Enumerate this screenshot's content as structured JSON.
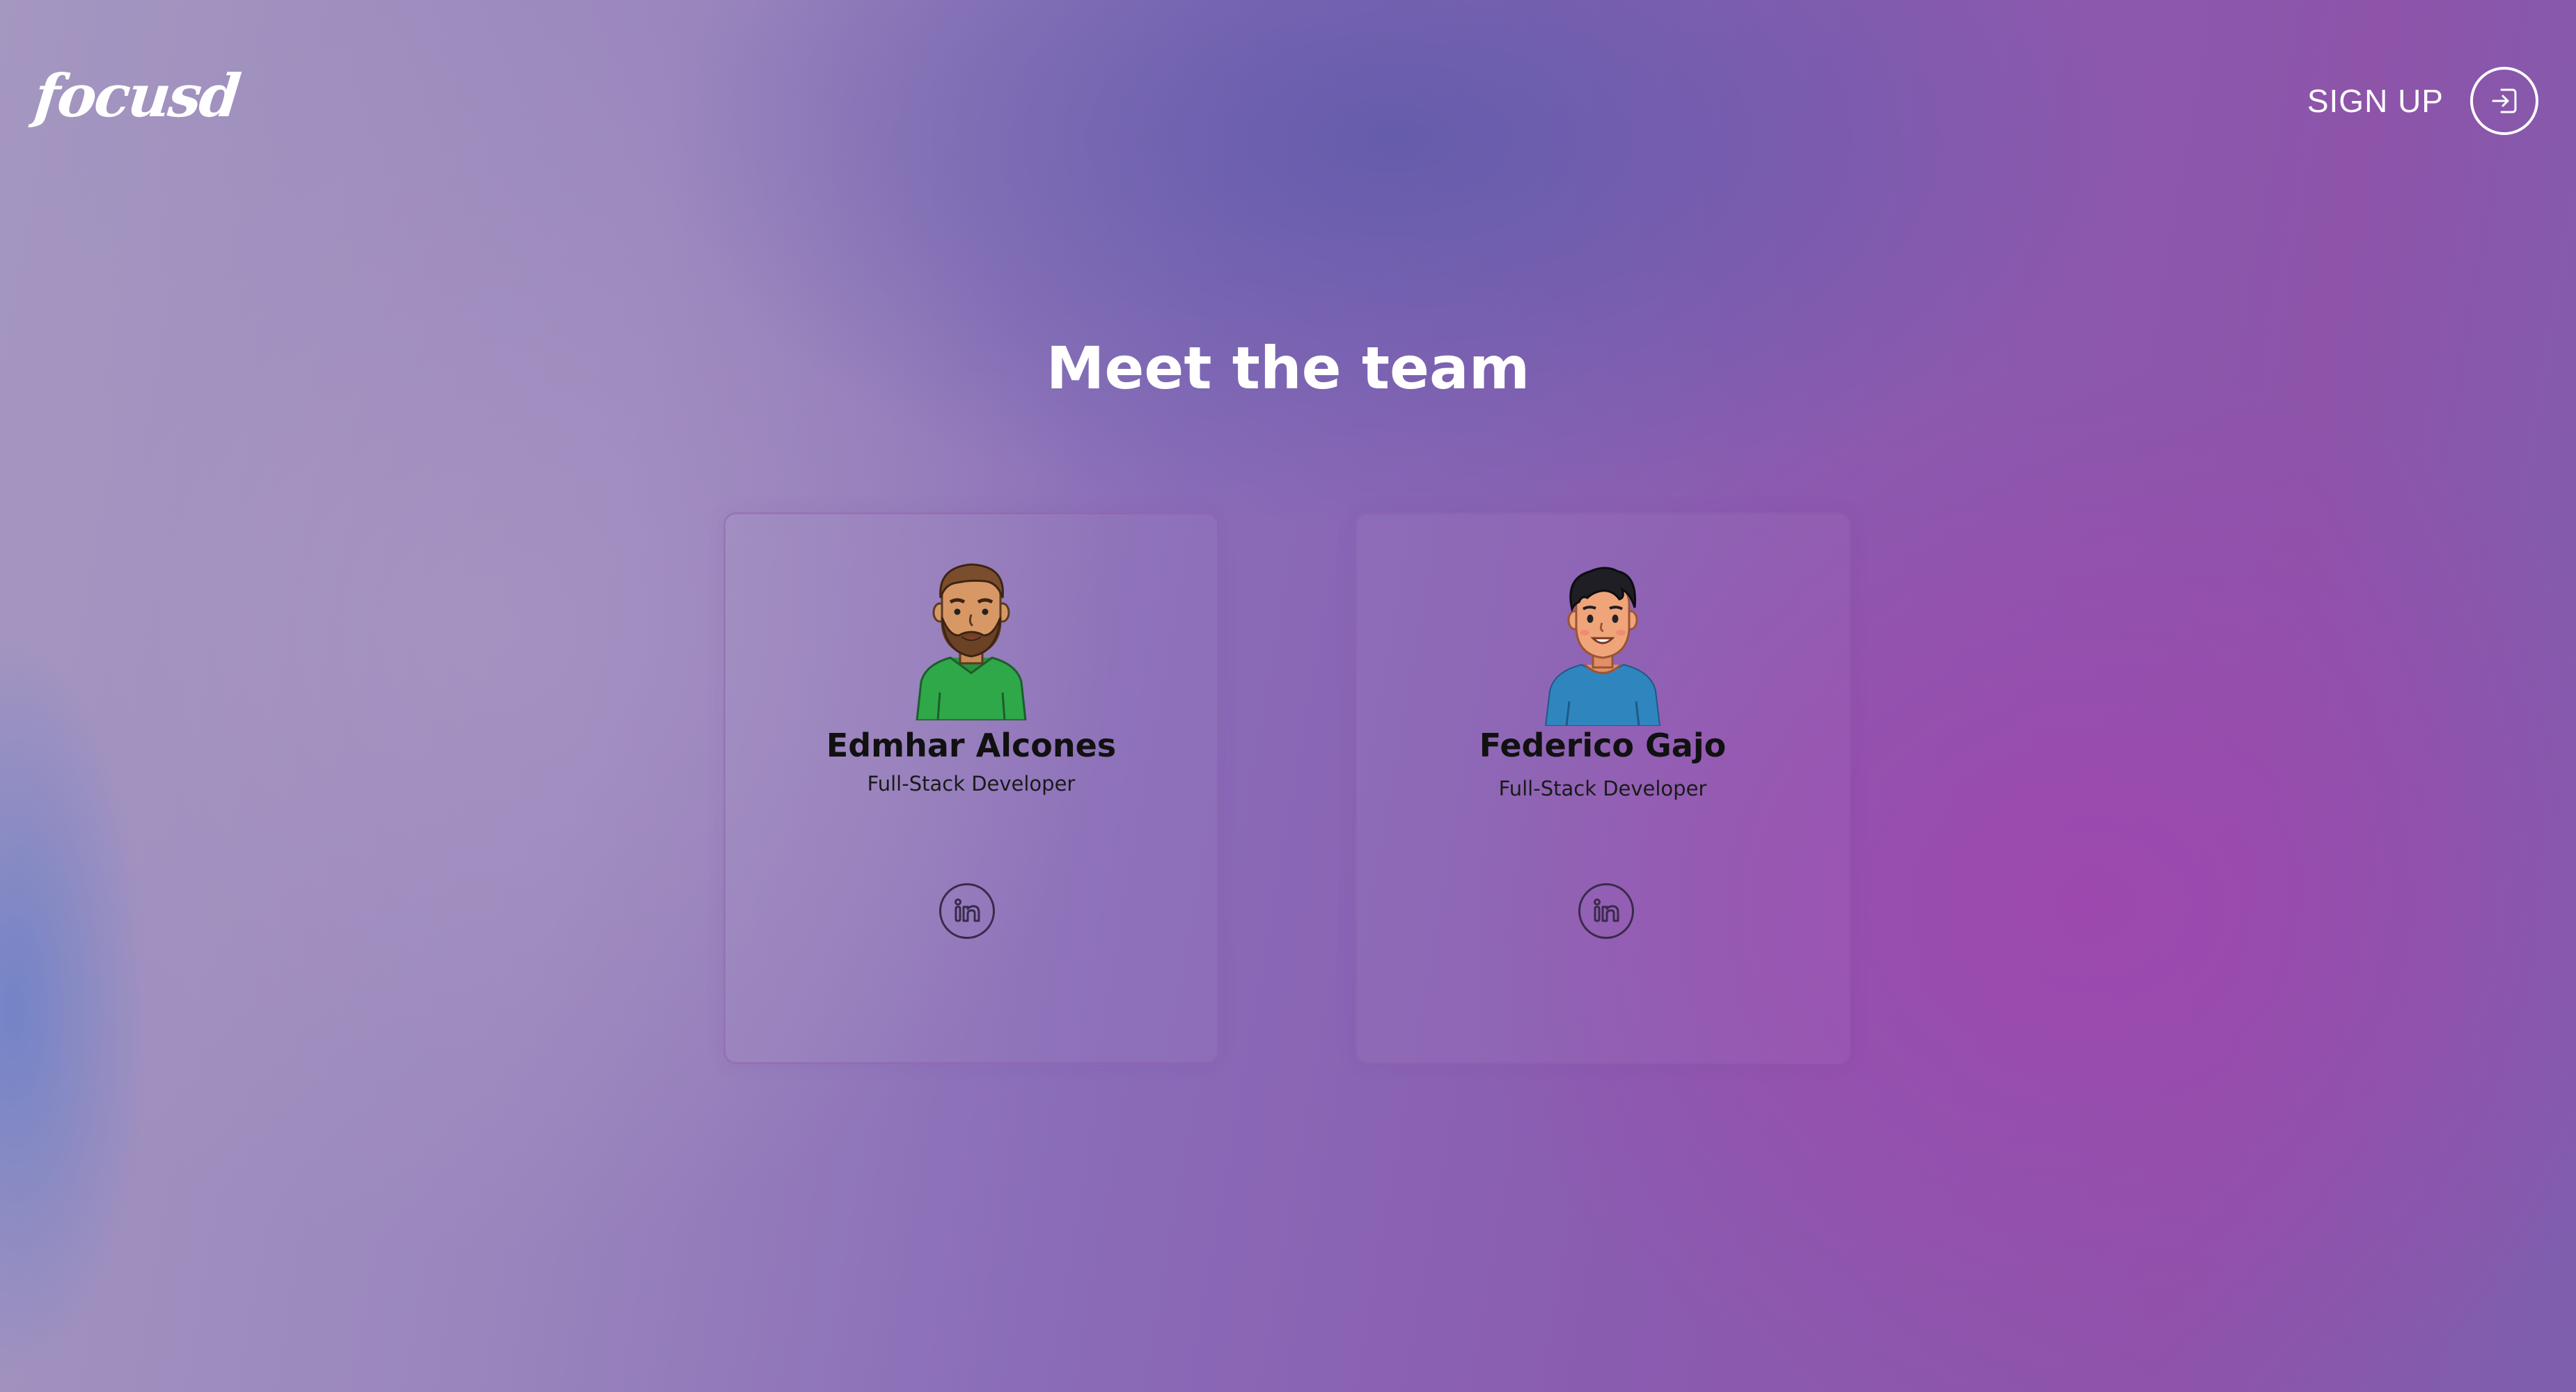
{
  "header": {
    "logo_text": "focusd",
    "signup_label": "SIGN UP",
    "signup_icon": "sign-in-icon"
  },
  "main": {
    "heading": "Meet the team",
    "members": [
      {
        "name": "Edmhar Alcones",
        "role": "Full-Stack Developer",
        "avatar": "bearded-man-green-shirt-avatar",
        "social_icon": "linkedin-icon"
      },
      {
        "name": "Federico Gajo",
        "role": "Full-Stack Developer",
        "avatar": "young-man-blue-shirt-avatar",
        "social_icon": "linkedin-icon"
      }
    ]
  },
  "colors": {
    "text_light": "#ffffff",
    "text_dark": "#111111",
    "bg_left": "#a497c0",
    "bg_center": "#8a6cb8",
    "bg_right": "#8d54aa",
    "shirt_green": "#2fa84a",
    "shirt_blue": "#2f86bf"
  }
}
